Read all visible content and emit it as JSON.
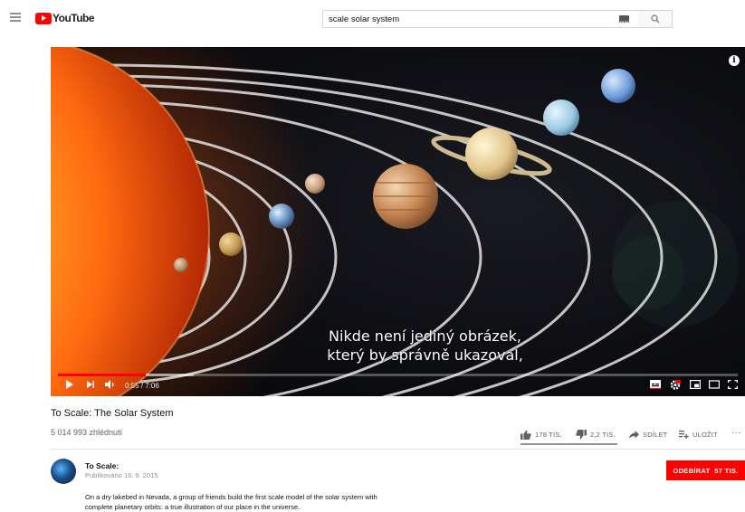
{
  "header": {
    "logo_text": "YouTube",
    "search_value": "scale solar system",
    "colors": {
      "brand": "#ff0000"
    }
  },
  "player": {
    "subtitle_line1": "Nikde není jediný obrázek,",
    "subtitle_line2": "který by správně ukazoval,",
    "time": "0:55 / 7:06",
    "progress_fraction": 0.129,
    "buffered_fraction": 0.2,
    "info_glyph": "i",
    "icons": [
      "play-icon",
      "next-icon",
      "volume-icon",
      "subtitles-icon",
      "settings-icon",
      "miniplayer-icon",
      "theater-icon",
      "fullscreen-icon"
    ]
  },
  "video": {
    "title": "To Scale: The Solar System",
    "views": "5 014 993 zhlédnutí",
    "like_count": "178 TIS.",
    "dislike_count": "2,2 TIS.",
    "share_label": "SDÍLET",
    "save_label": "ULOŽIT",
    "more_label": "···"
  },
  "channel": {
    "name": "To Scale:",
    "published": "Publikováno 16. 9. 2015",
    "subscribe_label": "ODEBÍRAT",
    "subscriber_count": "57 TIS.",
    "description_line1": "On a dry lakebed in Nevada, a group of friends build the first scale model of the solar system with",
    "description_line2": "complete planetary orbits: a true illustration of our place in the universe."
  }
}
